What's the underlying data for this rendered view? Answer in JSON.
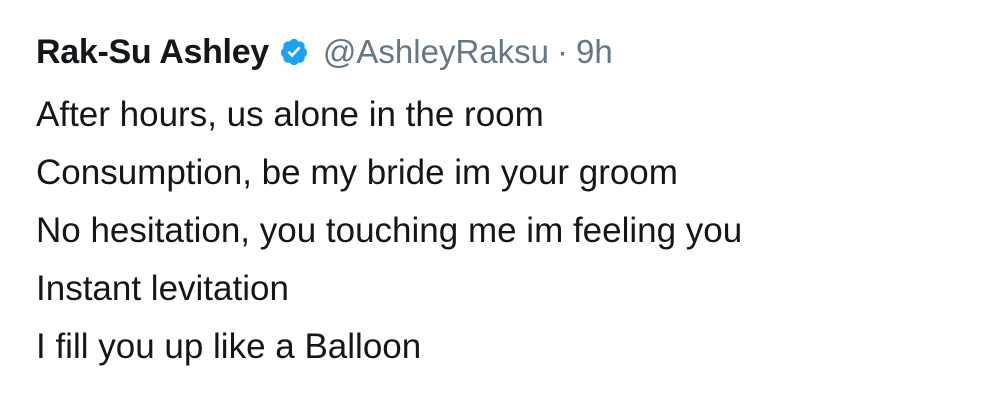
{
  "tweet": {
    "author_name": "Rak-Su Ashley",
    "verified_icon": "verified-badge-icon",
    "handle": "@AshleyRaksu",
    "separator": "·",
    "time": "9h",
    "lines": [
      "After hours, us alone in the room",
      "Consumption, be my bride im your groom",
      "No hesitation, you touching me im feeling you",
      "Instant levitation",
      "I fill you up like a Balloon"
    ]
  },
  "colors": {
    "text": "#14171a",
    "muted": "#657786",
    "verified": "#1da1f2"
  }
}
